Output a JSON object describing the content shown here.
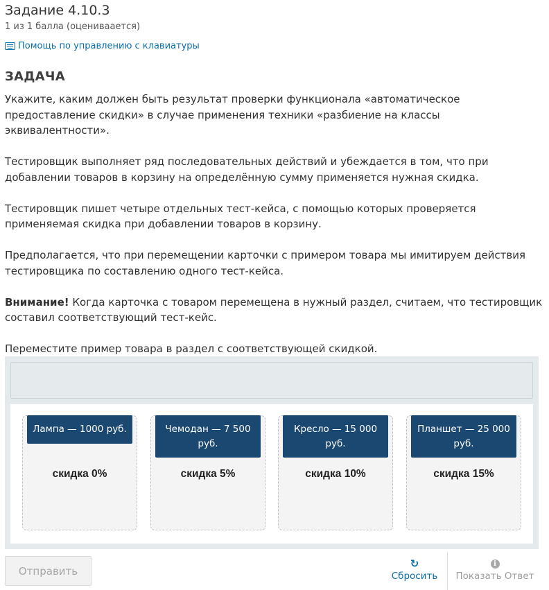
{
  "header": {
    "title": "Задание 4.10.3",
    "score": "1 из 1 балла (оцениваается)",
    "keyboard_help": "Помощь по управлению с клавиатуры"
  },
  "task": {
    "heading": "ЗАДАЧА",
    "paragraphs": [
      "Укажите, каким должен быть результат проверки функционала «автоматическое предоставление скидки» в случае применения техники «разбиение на классы эквивалентности».",
      "Тестировщик выполняет ряд последовательных действий и убеждается в том, что при добавлении товаров в корзину на определённую сумму применяется нужная скидка.",
      "Тестировщик пишет четыре отдельных тест-кейса, с помощью которых проверяется применяемая скидка при добавлении товаров в корзину.",
      "Предполагается, что при перемещении карточки с примером товара мы имитируем действия тестировщика по составлению одного тест-кейса."
    ],
    "attention_label": "Внимание!",
    "attention_text": " Когда карточка с товаром перемещена в нужный раздел, считаем, что тестировщик составил соответствующий тест-кейс.",
    "instruction": "Переместите пример товара в раздел с соответствующей скидкой."
  },
  "drag_drop": {
    "zones": [
      {
        "label": "скидка 0%",
        "item": "Лампа — 1000 руб."
      },
      {
        "label": "скидка 5%",
        "item": "Чемодан — 7 500 руб."
      },
      {
        "label": "скидка 10%",
        "item": "Кресло — 15 000 руб."
      },
      {
        "label": "скидка 15%",
        "item": "Планшет — 25 000 руб."
      }
    ],
    "card_color": "#1a4870"
  },
  "actions": {
    "submit_label": "Отправить",
    "reset_label": "Сбросить",
    "show_answer_label": "Показать Ответ",
    "reset_icon": "refresh-icon",
    "show_answer_icon": "info-icon",
    "link_color": "#0a6ea8"
  }
}
